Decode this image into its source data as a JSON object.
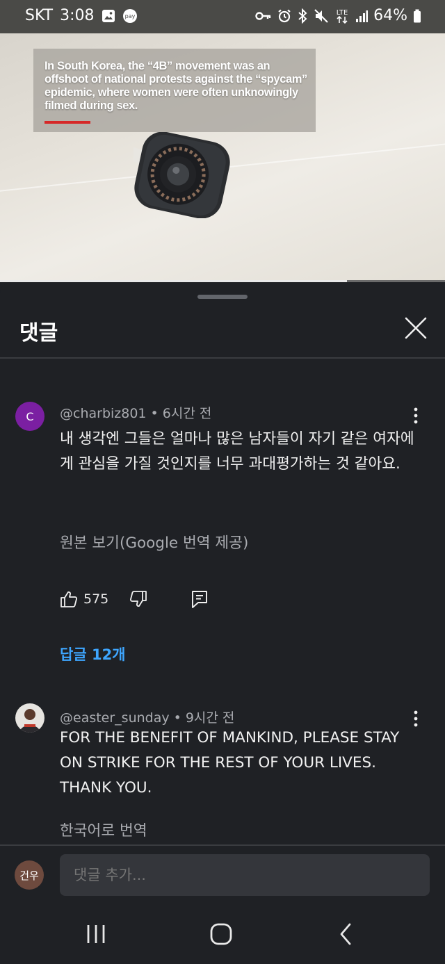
{
  "status_bar": {
    "carrier": "SKT",
    "time": "3:08",
    "battery": "64%",
    "icons": [
      "gallery-icon",
      "pay-icon",
      "vpn-key-icon",
      "alarm-icon",
      "bluetooth-icon",
      "mute-icon",
      "lte-icon",
      "signal-icon",
      "battery-icon"
    ],
    "pay_label": "pay",
    "lte_label": "LTE"
  },
  "video": {
    "caption": "In South Korea, the “4B” movement was an offshoot of national protests against the “spycam” epidemic, where women were often unknowingly filmed during sex.",
    "progress_fraction": 0.78,
    "caption_accent_color": "#d62828"
  },
  "comments_panel": {
    "title": "댓글",
    "close_icon": "close-icon"
  },
  "comments": [
    {
      "avatar_letter": "C",
      "avatar_color": "#7b1fa2",
      "author": "@charbiz801",
      "time": "6시간 전",
      "text": "내 생각엔 그들은 얼마나 많은 남자들이 자기 같은 여자에게 관심을 가질 것인지를 너무 과대평가하는 것 같아요.",
      "translate_label": "원본 보기(Google 번역 제공)",
      "likes": "575",
      "replies_label": "답글 12개"
    },
    {
      "author": "@easter_sunday",
      "time": "9시간 전",
      "text": "FOR THE BENEFIT OF MANKIND, PLEASE STAY ON STRIKE FOR THE REST OF YOUR LIVES. THANK YOU.",
      "translate_label": "한국어로 번역"
    }
  ],
  "composer": {
    "user_initials": "건우",
    "placeholder": "댓글 추가..."
  },
  "nav_bar": {
    "buttons": [
      "recents-icon",
      "home-icon",
      "back-icon"
    ]
  },
  "colors": {
    "background": "#1f2125",
    "link_blue": "#3ea6ff",
    "secondary_text": "#a9abb0"
  }
}
